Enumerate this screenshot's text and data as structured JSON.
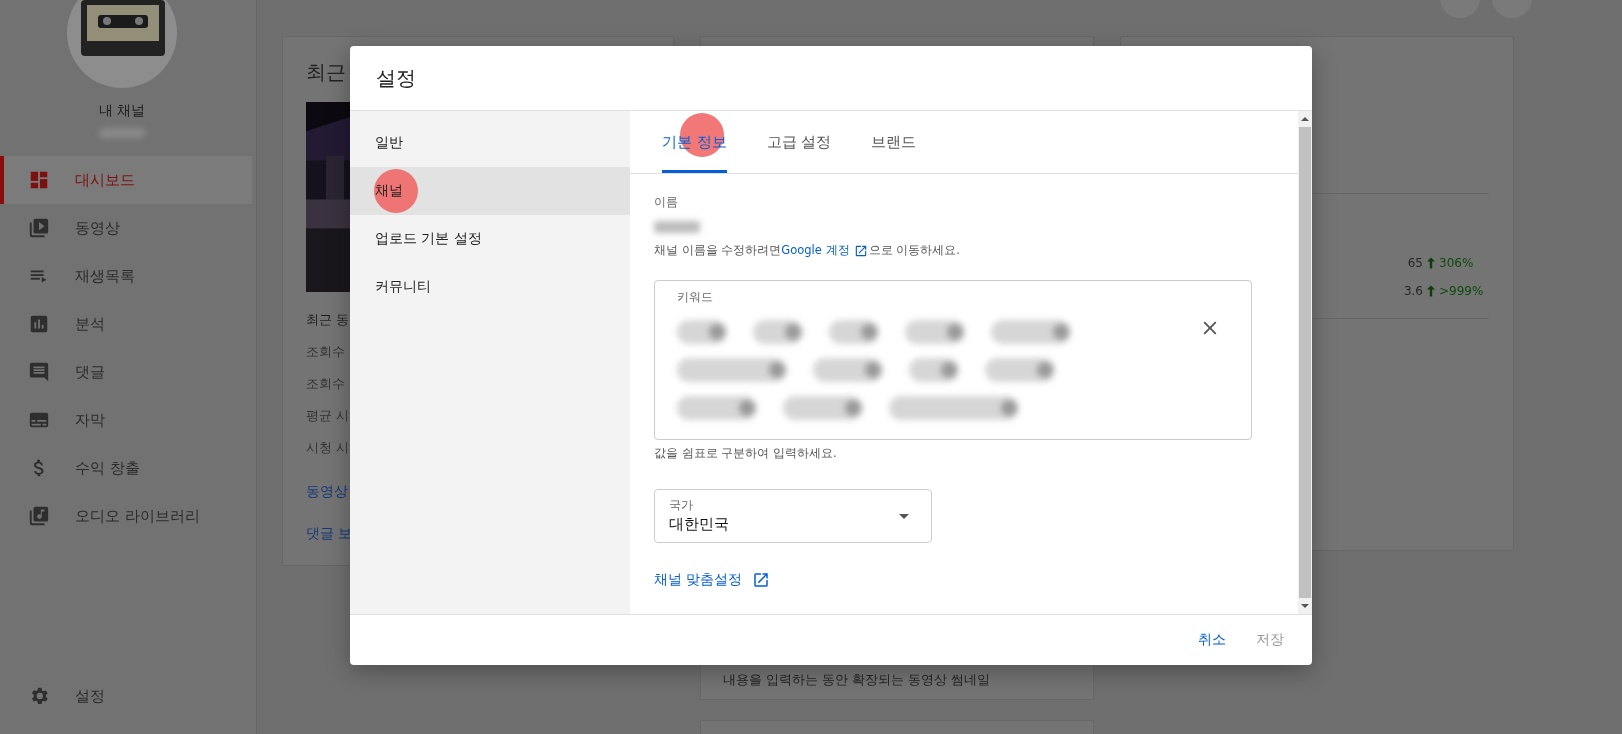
{
  "sidebar": {
    "channel_title": "내 채널",
    "nav": [
      {
        "label": "대시보드",
        "selected": true
      },
      {
        "label": "동영상",
        "selected": false
      },
      {
        "label": "재생목록",
        "selected": false
      },
      {
        "label": "분석",
        "selected": false
      },
      {
        "label": "댓글",
        "selected": false
      },
      {
        "label": "자막",
        "selected": false
      },
      {
        "label": "수익 창출",
        "selected": false
      },
      {
        "label": "오디오 라이브러리",
        "selected": false
      }
    ],
    "settings": {
      "label": "설정"
    }
  },
  "dashboard": {
    "recent_card": {
      "title": "최근",
      "subtitle": "최근 동",
      "rows": [
        "조회수",
        "조회수",
        "평균 시",
        "시청 시"
      ],
      "links": [
        "동영상",
        "댓글 보"
      ]
    },
    "middle_card": {
      "text": "내용을 입력하는 동안 확장되는 동영상 썸네일"
    },
    "stats_card": {
      "rows": [
        {
          "value": "65",
          "change": "306%"
        },
        {
          "value": "3.6",
          "change": ">999%"
        }
      ]
    }
  },
  "dialog": {
    "title": "설정",
    "nav": [
      {
        "label": "일반",
        "selected": false
      },
      {
        "label": "채널",
        "selected": true
      },
      {
        "label": "업로드 기본 설정",
        "selected": false
      },
      {
        "label": "커뮤니티",
        "selected": false
      }
    ],
    "tabs": [
      {
        "label": "기본 정보",
        "selected": true
      },
      {
        "label": "고급 설정",
        "selected": false
      },
      {
        "label": "브랜드",
        "selected": false
      }
    ],
    "name_label": "이름",
    "name_help": {
      "before": "채널 이름을 수정하려면 ",
      "link": "Google 계정",
      "after": "으로 이동하세요."
    },
    "keywords": {
      "label": "키워드",
      "help": "값을 쉼표로 구분하여 입력하세요."
    },
    "country": {
      "label": "국가",
      "value": "대한민국"
    },
    "customize_link": "채널 맞춤설정",
    "buttons": [
      {
        "label": "취소",
        "disabled": false
      },
      {
        "label": "저장",
        "disabled": true
      }
    ]
  }
}
